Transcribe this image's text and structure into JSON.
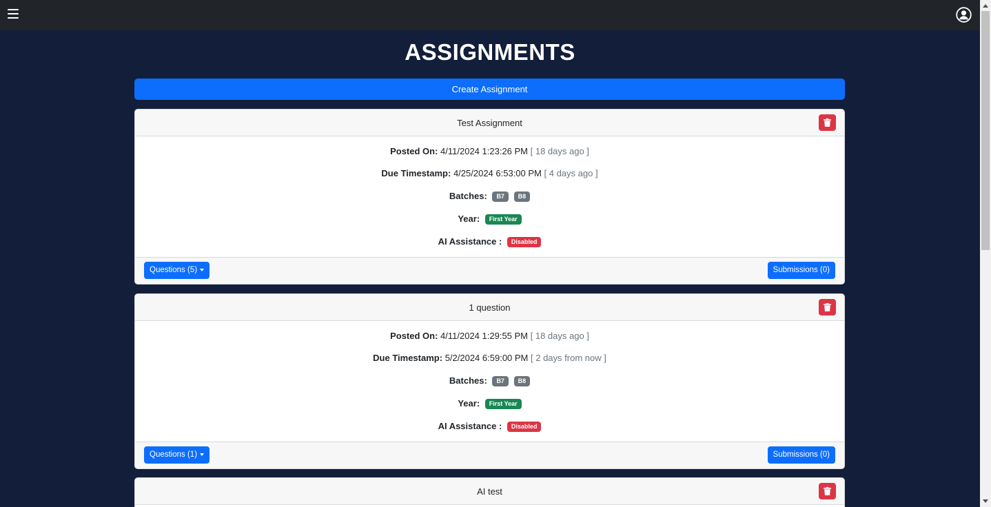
{
  "header": {
    "menu_icon": "hamburger-icon",
    "profile_icon": "user-circle-icon"
  },
  "page": {
    "title": "ASSIGNMENTS",
    "create_label": "Create Assignment"
  },
  "labels": {
    "posted_on": "Posted On:",
    "due": "Due Timestamp:",
    "batches": "Batches:",
    "year": "Year:",
    "ai": "AI Assistance :"
  },
  "assignments": [
    {
      "title": "Test Assignment",
      "posted": "4/11/2024 1:23:26 PM",
      "posted_rel": "[ 18 days ago ]",
      "due": "4/25/2024 6:53:00 PM",
      "due_rel": "[ 4 days ago ]",
      "batches": [
        "B7",
        "B8"
      ],
      "year": "First Year",
      "ai": "Disabled",
      "questions_label": "Questions (5)",
      "submissions_label": "Submissions (0)"
    },
    {
      "title": "1 question",
      "posted": "4/11/2024 1:29:55 PM",
      "posted_rel": "[ 18 days ago ]",
      "due": "5/2/2024 6:59:00 PM",
      "due_rel": "[ 2 days from now ]",
      "batches": [
        "B7",
        "B8"
      ],
      "year": "First Year",
      "ai": "Disabled",
      "questions_label": "Questions (1)",
      "submissions_label": "Submissions (0)"
    },
    {
      "title": "AI test"
    }
  ],
  "colors": {
    "background": "#131e3a",
    "navbar": "#212529",
    "primary": "#0d6efd",
    "danger": "#dc3545",
    "success": "#198754",
    "secondary": "#6c757d"
  }
}
